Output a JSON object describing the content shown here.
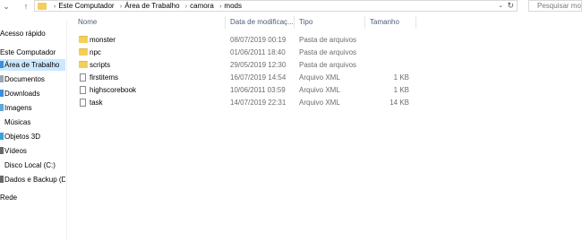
{
  "address_bar": {
    "crumbs": [
      "Este Computador",
      "Área de Trabalho",
      "camora",
      "mods"
    ]
  },
  "search": {
    "placeholder": "Pesquisar mods"
  },
  "sidebar": {
    "items": [
      {
        "label": "Acesso rápido"
      },
      {
        "label": "Este Computador"
      },
      {
        "label": "Área de Trabalho",
        "selected": true
      },
      {
        "label": "Documentos"
      },
      {
        "label": "Downloads"
      },
      {
        "label": "Imagens"
      },
      {
        "label": "Músicas"
      },
      {
        "label": "Objetos 3D"
      },
      {
        "label": "Vídeos"
      },
      {
        "label": "Disco Local (C:)"
      },
      {
        "label": "Dados e Backup (D:"
      },
      {
        "label": "Rede"
      }
    ]
  },
  "columns": {
    "name": "Nome",
    "date": "Data de modificaç...",
    "type": "Tipo",
    "size": "Tamanho"
  },
  "files": [
    {
      "name": "monster",
      "date": "08/07/2019 00:19",
      "type": "Pasta de arquivos",
      "size": "",
      "icon": "folder-icon"
    },
    {
      "name": "npc",
      "date": "01/06/2011 18:40",
      "type": "Pasta de arquivos",
      "size": "",
      "icon": "folder-icon"
    },
    {
      "name": "scripts",
      "date": "29/05/2019 12:30",
      "type": "Pasta de arquivos",
      "size": "",
      "icon": "folder-icon"
    },
    {
      "name": "firstitems",
      "date": "16/07/2019 14:54",
      "type": "Arquivo XML",
      "size": "1 KB",
      "icon": "file-icon"
    },
    {
      "name": "highscorebook",
      "date": "10/06/2011 03:59",
      "type": "Arquivo XML",
      "size": "1 KB",
      "icon": "file-icon"
    },
    {
      "name": "task",
      "date": "14/07/2019 22:31",
      "type": "Arquivo XML",
      "size": "14 KB",
      "icon": "file-icon"
    }
  ],
  "colors": {
    "selection": "#cce8ff",
    "folder": "#f3cf5a",
    "header_text": "#4c607a"
  }
}
